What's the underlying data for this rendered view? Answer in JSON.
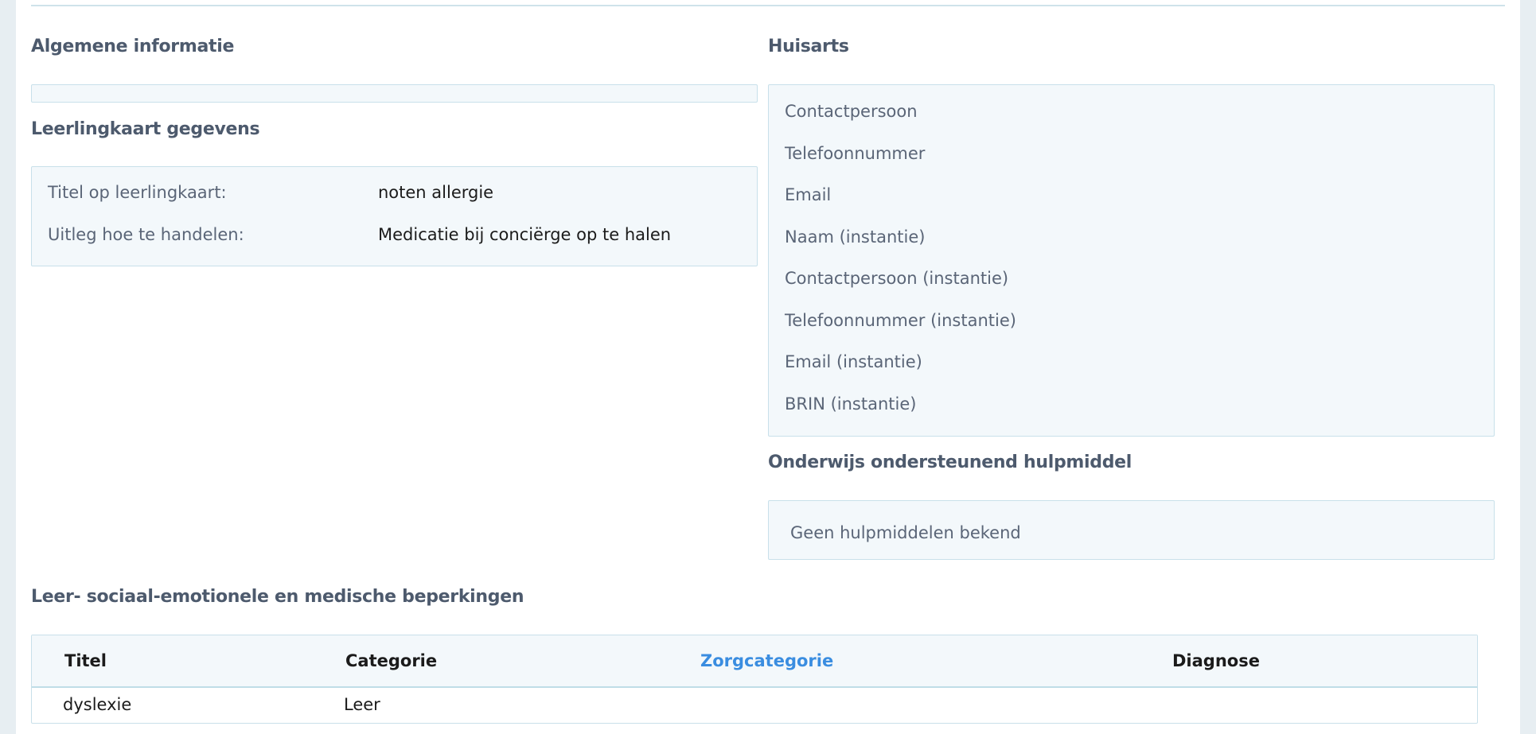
{
  "general": {
    "title": "Algemene informatie"
  },
  "leerlingkaart": {
    "title": "Leerlingkaart gegevens",
    "rows": [
      {
        "label": "Titel op leerlingkaart:",
        "value": "noten allergie"
      },
      {
        "label": "Uitleg hoe te handelen:",
        "value": "Medicatie bij conciërge op te halen"
      }
    ]
  },
  "huisarts": {
    "title": "Huisarts",
    "items": [
      "Contactpersoon",
      "Telefoonnummer",
      "Email",
      "Naam (instantie)",
      "Contactpersoon (instantie)",
      "Telefoonnummer (instantie)",
      "Email (instantie)",
      "BRIN (instantie)"
    ]
  },
  "hulpmiddel": {
    "title": "Onderwijs ondersteunend hulpmiddel",
    "empty_text": "Geen hulpmiddelen bekend"
  },
  "beperkingen": {
    "title": "Leer- sociaal-emotionele en medische beperkingen",
    "columns": [
      "Titel",
      "Categorie",
      "Zorgcategorie",
      "Diagnose"
    ],
    "rows": [
      {
        "titel": "dyslexie",
        "categorie": "Leer",
        "zorgcategorie": "",
        "diagnose": ""
      }
    ]
  },
  "colors": {
    "accent": "#3a8de0",
    "box_bg": "#f3f8fb",
    "box_border": "#c8e0ea",
    "page_bg": "#e7eef2"
  }
}
